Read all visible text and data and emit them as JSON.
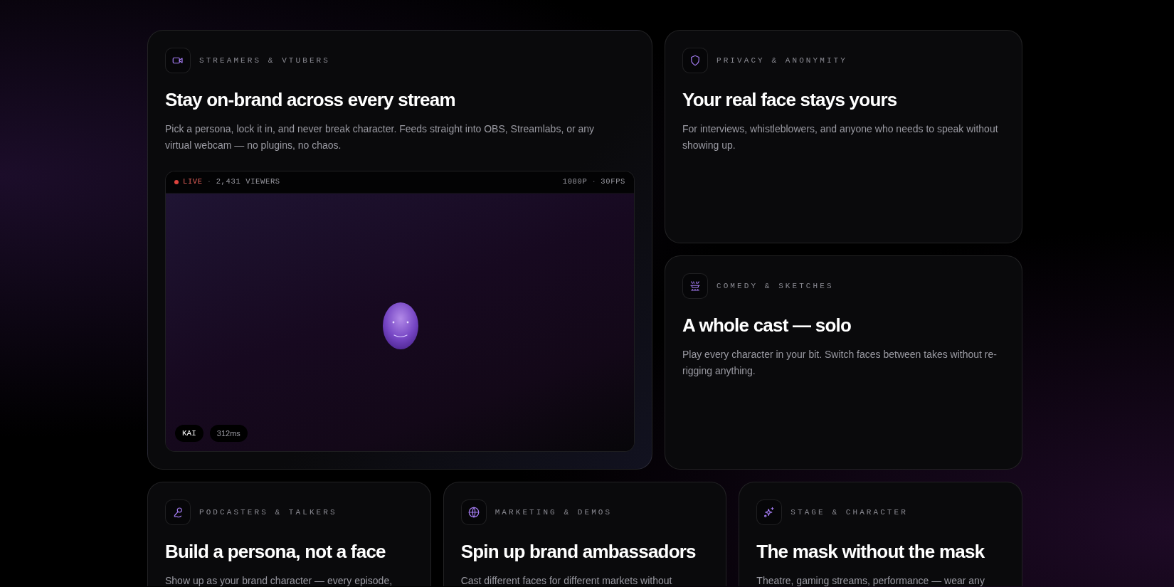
{
  "featured": {
    "label": "STREAMERS & VTUBERS",
    "title": "Stay on-brand across every stream",
    "description": "Pick a persona, lock it in, and never break character. Feeds straight into OBS, Streamlabs, or any virtual webcam — no plugins, no chaos.",
    "preview": {
      "left_items": [
        {
          "kind": "live",
          "text": "LIVE"
        },
        {
          "kind": "sep",
          "text": "·"
        },
        {
          "kind": "plain",
          "text": "2,431 VIEWERS"
        }
      ],
      "right_items": [
        {
          "kind": "plain",
          "text": "1080P"
        },
        {
          "kind": "sep",
          "text": "·"
        },
        {
          "kind": "plain",
          "text": "30FPS"
        }
      ],
      "badges": [
        {
          "kind": "name",
          "text": "KAI"
        },
        {
          "kind": "latency",
          "text": "312ms"
        }
      ]
    }
  },
  "side_cards": [
    {
      "label": "PRIVACY & ANONYMITY",
      "title": "Your real face stays yours",
      "description": "For interviews, whistleblowers, and anyone who needs to speak without showing up."
    },
    {
      "label": "COMEDY & SKETCHES",
      "title": "A whole cast — solo",
      "description": "Play every character in your bit. Switch faces between takes without re-rigging anything."
    }
  ],
  "bottom_cards": [
    {
      "label": "PODCASTERS & TALKERS",
      "title": "Build a persona, not a face",
      "description": "Show up as your brand character — every episode,"
    },
    {
      "label": "MARKETING & DEMOS",
      "title": "Spin up brand ambassadors",
      "description": "Cast different faces for different markets without"
    },
    {
      "label": "STAGE & CHARACTER",
      "title": "The mask without the mask",
      "description": "Theatre, gaming streams, performance — wear any"
    }
  ]
}
